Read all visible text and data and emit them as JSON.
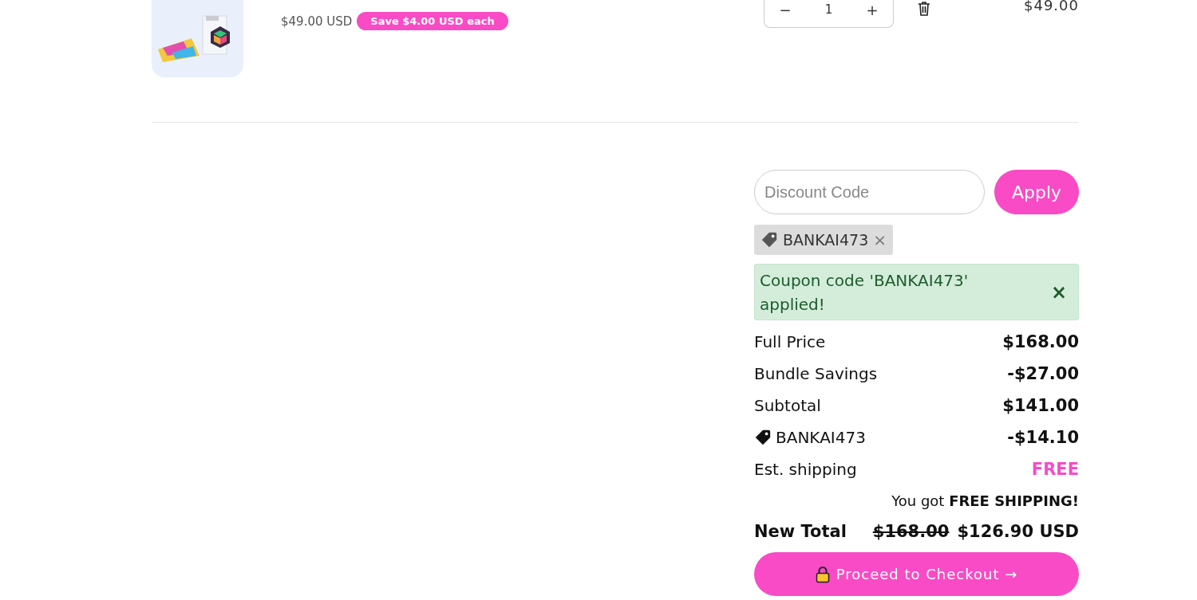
{
  "cart_item": {
    "price": "$49.00 USD",
    "savings_badge": "Save $4.00 USD each",
    "quantity": {
      "decrease": "−",
      "value": "1",
      "increase": "+"
    },
    "line_total": "$49.00"
  },
  "discount": {
    "placeholder": "Discount Code",
    "apply_button": "Apply"
  },
  "applied_codes": [
    {
      "code": "BANKAI473",
      "remove": "×"
    }
  ],
  "alert": {
    "message": "Coupon code 'BANKAI473' applied!",
    "close": "×"
  },
  "summary_rows": [
    {
      "kind": "plain",
      "label": "Full Price",
      "value": "$168.00"
    },
    {
      "kind": "plain",
      "label": "Bundle Savings",
      "value": "-$27.00"
    },
    {
      "kind": "plain",
      "label": "Subtotal",
      "value": "$141.00"
    },
    {
      "kind": "coupon",
      "label": "BANKAI473",
      "value": "-$14.10"
    },
    {
      "kind": "highlight",
      "label": "Est. shipping",
      "value": "FREE"
    }
  ],
  "shipping_note": "You got **FREE SHIPPING!**",
  "new_total": {
    "label": "New Total",
    "original": "$168.00",
    "total": "$126.90 USD"
  },
  "checkout_button": "Proceed to Checkout →"
}
